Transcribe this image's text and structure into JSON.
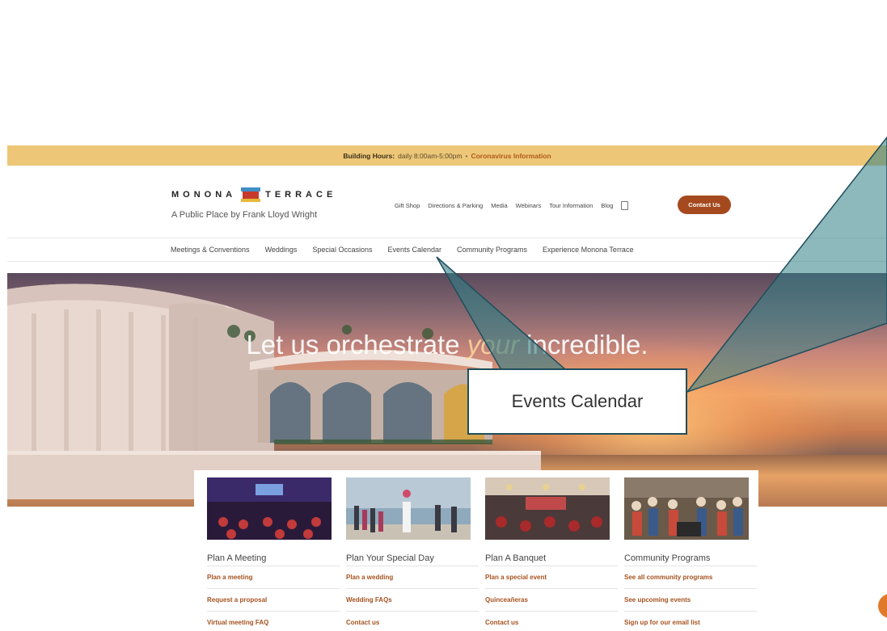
{
  "hours_bar": {
    "label": "Building Hours:",
    "hours": "daily 8:00am-5:00pm",
    "separator": "•",
    "link": "Coronavirus Information"
  },
  "brand": {
    "name_left": "MONONA",
    "name_right": "TERRACE",
    "tagline": "A Public Place by Frank Lloyd Wright"
  },
  "utility_nav": [
    "Gift Shop",
    "Directions & Parking",
    "Media",
    "Webinars",
    "Tour Information",
    "Blog"
  ],
  "contact_button": "Contact Us",
  "main_nav": [
    "Meetings & Conventions",
    "Weddings",
    "Special Occasions",
    "Events Calendar",
    "Community Programs",
    "Experience Monona Terrace"
  ],
  "hero": {
    "title_before": "Let us orchestrate ",
    "title_emphasis": "your",
    "title_after": " incredible."
  },
  "callout": {
    "label": "Events Calendar"
  },
  "cards": [
    {
      "title": "Plan A Meeting",
      "links": [
        "Plan a meeting",
        "Request a proposal",
        "Virtual meeting FAQ"
      ]
    },
    {
      "title": "Plan Your Special Day",
      "links": [
        "Plan a wedding",
        "Wedding FAQs",
        "Contact us"
      ]
    },
    {
      "title": "Plan A Banquet",
      "links": [
        "Plan a special event",
        "Quinceañeras",
        "Contact us"
      ]
    },
    {
      "title": "Community Programs",
      "links": [
        "See all community programs",
        "See upcoming events",
        "Sign up for our email list"
      ]
    }
  ],
  "colors": {
    "accent": "#a54a1e",
    "hours_bar": "#edc777",
    "callout_teal": "#2f7f86"
  }
}
